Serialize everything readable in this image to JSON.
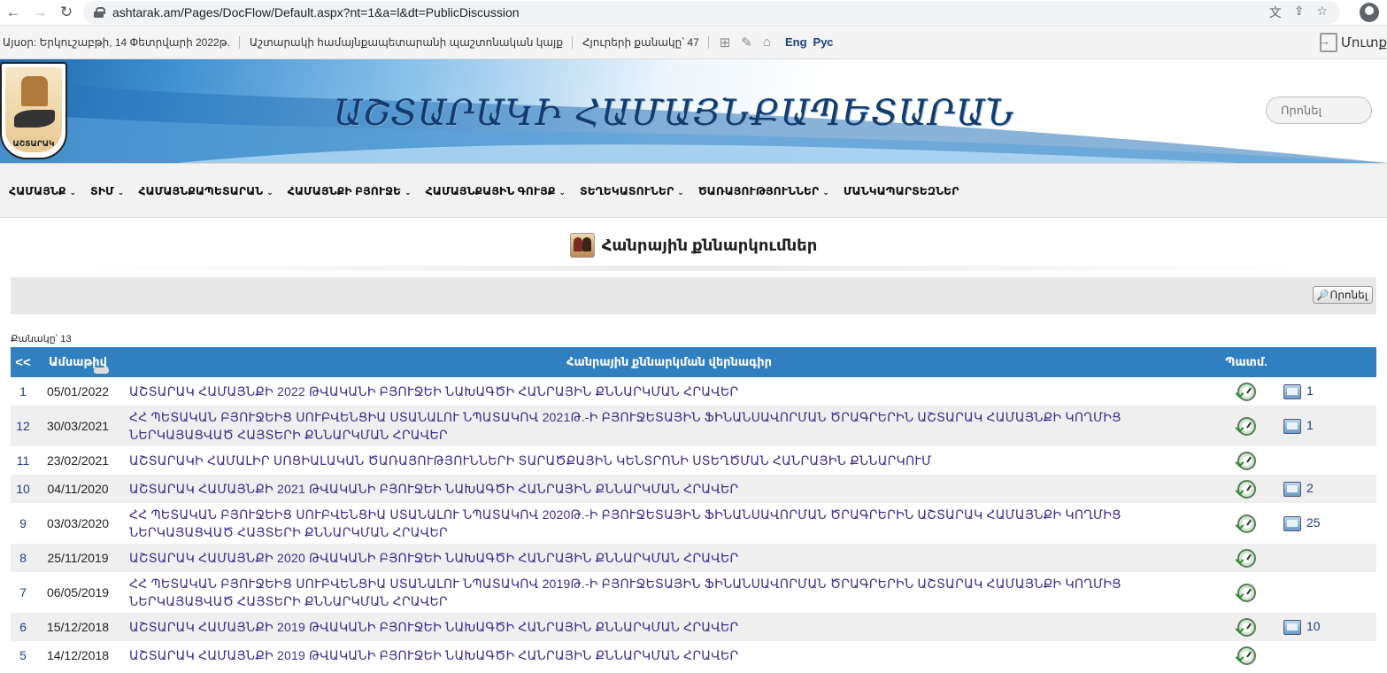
{
  "browser": {
    "url": "ashtarak.am/Pages/DocFlow/Default.aspx?nt=1&a=l&dt=PublicDiscussion"
  },
  "topstrip": {
    "today": "Այսօր: Երկուշաբթի, 14 Փետրվարի 2022թ.",
    "official": "Աշտարակի համայնքապետարանի պաշտոնական կայք",
    "visitors": "Հյուրերի քանակը՝ 47",
    "lang_en": "Eng",
    "lang_ru": "Рус",
    "login": "Մուտք"
  },
  "banner": {
    "crest_text": "ԱՇՏԱՐԱԿ",
    "title": "ԱՇՏԱՐԱԿԻ ՀԱՄԱՅՆՔԱՊԵՏԱՐԱՆ",
    "search_placeholder": "Որոնել"
  },
  "nav": [
    {
      "label": "ՀԱՄԱՅՆՔ",
      "dropdown": true
    },
    {
      "label": "ՏԻՄ",
      "dropdown": true
    },
    {
      "label": "ՀԱՄԱՅՆՔԱՊԵՏԱՐԱՆ",
      "dropdown": true
    },
    {
      "label": "ՀԱՄԱՅՆՔԻ ԲՅՈՒՋԵ",
      "dropdown": true
    },
    {
      "label": "ՀԱՄԱՅՆՔԱՅԻՆ ԳՈՒՅՔ",
      "dropdown": true
    },
    {
      "label": "ՏԵՂԵԿԱՏՈՒՆԵՐ",
      "dropdown": true
    },
    {
      "label": "ԾԱՌԱՅՈՒԹՅՈՒՆՆԵՐ",
      "dropdown": true
    },
    {
      "label": "ՄԱՆԿԱՊԱՐՏԵԶՆԵՐ",
      "dropdown": false
    }
  ],
  "page": {
    "heading": "Հանրային քննարկումներ",
    "search_button": "Որոնել",
    "count": "Քանակը՝ 13"
  },
  "table": {
    "headers": {
      "back": "<<",
      "date": "Ամսաթիվ",
      "title": "Հանրային քննարկման վերնագիր",
      "history": "Պատմ."
    },
    "rows": [
      {
        "num": "1",
        "date": "05/01/2022",
        "title": "ԱՇՏԱՐԱԿ ՀԱՄԱՅՆՔԻ 2022 ԹՎԱԿԱՆԻ ԲՅՈՒՋԵԻ ՆԱԽԱԳԾԻ ՀԱՆՐԱՅԻՆ ՔՆՆԱՐԿՄԱՆ ՀՐԱՎԵՐ",
        "comments": "1"
      },
      {
        "num": "12",
        "date": "30/03/2021",
        "title": "ՀՀ ՊԵՏԱԿԱՆ ԲՅՈՒՋԵԻՑ ՍՈՒԲՎԵՆՑԻԱ ՍՏԱՆԱԼՈՒ ՆՊԱՏԱԿՈՎ 2021Թ.-Ի ԲՅՈՒՋԵՏԱՅԻՆ ՖԻՆԱՆՍԱՎՈՐՄԱՆ ԾՐԱԳՐԵՐԻՆ ԱՇՏԱՐԱԿ ՀԱՄԱՅՆՔԻ ԿՈՂՄԻՑ ՆԵՐԿԱՅԱՑՎԱԾ ՀԱՅՏԵՐԻ ՔՆՆԱՐԿՄԱՆ ՀՐԱՎԵՐ",
        "comments": "1"
      },
      {
        "num": "11",
        "date": "23/02/2021",
        "title": "ԱՇՏԱՐԱԿԻ ՀԱՄԱԼԻՐ ՍՈՑԻԱԼԱԿԱՆ ԾԱՌԱՅՈՒԹՅՈՒՆՆԵՐԻ ՏԱՐԱԾՔԱՅԻՆ ԿԵՆՏՐՈՆԻ ՍՏԵՂԾՄԱՆ ՀԱՆՐԱՅԻՆ ՔՆՆԱՐԿՈՒՄ",
        "comments": ""
      },
      {
        "num": "10",
        "date": "04/11/2020",
        "title": "ԱՇՏԱՐԱԿ ՀԱՄԱՅՆՔԻ 2021 ԹՎԱԿԱՆԻ ԲՅՈՒՋԵԻ ՆԱԽԱԳԾԻ ՀԱՆՐԱՅԻՆ ՔՆՆԱՐԿՄԱՆ ՀՐԱՎԵՐ",
        "comments": "2"
      },
      {
        "num": "9",
        "date": "03/03/2020",
        "title": "ՀՀ ՊԵՏԱԿԱՆ ԲՅՈՒՋԵԻՑ ՍՈՒԲՎԵՆՑԻԱ ՍՏԱՆԱԼՈՒ ՆՊԱՏԱԿՈՎ 2020Թ.-Ի ԲՅՈՒՋԵՏԱՅԻՆ ՖԻՆԱՆՍԱՎՈՐՄԱՆ ԾՐԱԳՐԵՐԻՆ ԱՇՏԱՐԱԿ ՀԱՄԱՅՆՔԻ ԿՈՂՄԻՑ ՆԵՐԿԱՅԱՑՎԱԾ ՀԱՅՏԵՐԻ ՔՆՆԱՐԿՄԱՆ ՀՐԱՎԵՐ",
        "comments": "25"
      },
      {
        "num": "8",
        "date": "25/11/2019",
        "title": "ԱՇՏԱՐԱԿ ՀԱՄԱՅՆՔԻ 2020 ԹՎԱԿԱՆԻ ԲՅՈՒՋԵԻ ՆԱԽԱԳԾԻ ՀԱՆՐԱՅԻՆ ՔՆՆԱՐԿՄԱՆ ՀՐԱՎԵՐ",
        "comments": ""
      },
      {
        "num": "7",
        "date": "06/05/2019",
        "title": "ՀՀ ՊԵՏԱԿԱՆ ԲՅՈՒՋԵԻՑ ՍՈՒԲՎԵՆՑԻԱ ՍՏԱՆԱԼՈՒ ՆՊԱՏԱԿՈՎ 2019Թ.-Ի ԲՅՈՒՋԵՏԱՅԻՆ ՖԻՆԱՆՍԱՎՈՐՄԱՆ ԾՐԱԳՐԵՐԻՆ ԱՇՏԱՐԱԿ ՀԱՄԱՅՆՔԻ ԿՈՂՄԻՑ ՆԵՐԿԱՅԱՑՎԱԾ ՀԱՅՏԵՐԻ ՔՆՆԱՐԿՄԱՆ ՀՐԱՎԵՐ",
        "comments": ""
      },
      {
        "num": "6",
        "date": "15/12/2018",
        "title": "ԱՇՏԱՐԱԿ ՀԱՄԱՅՆՔԻ 2019 ԹՎԱԿԱՆԻ ԲՅՈՒՋԵԻ ՆԱԽԱԳԾԻ ՀԱՆՐԱՅԻՆ ՔՆՆԱՐԿՄԱՆ ՀՐԱՎԵՐ",
        "comments": "10"
      },
      {
        "num": "5",
        "date": "14/12/2018",
        "title": "ԱՇՏԱՐԱԿ ՀԱՄԱՅՆՔԻ 2019 ԹՎԱԿԱՆԻ ԲՅՈՒՋԵԻ ՆԱԽԱԳԾԻ ՀԱՆՐԱՅԻՆ ՔՆՆԱՐԿՄԱՆ ՀՐԱՎԵՐ",
        "comments": ""
      }
    ]
  },
  "colors": {
    "header_blue": "#2f7fc1",
    "link_purple": "#3d2e8c",
    "banner_blue": "#1e64a8"
  },
  "icons": {
    "back": "arrow-left-icon",
    "forward": "arrow-right-icon",
    "reload": "reload-icon",
    "history": "history-clock-icon",
    "comments": "comment-icon"
  }
}
